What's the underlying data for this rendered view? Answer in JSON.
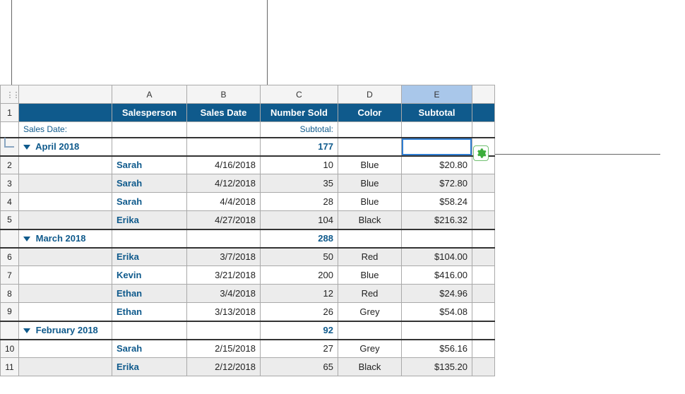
{
  "columns": {
    "A": "A",
    "B": "B",
    "C": "C",
    "D": "D",
    "E": "E"
  },
  "headers": {
    "salesperson": "Salesperson",
    "salesDate": "Sales Date",
    "numberSold": "Number Sold",
    "color": "Color",
    "subtotal": "Subtotal"
  },
  "labels": {
    "salesDate": "Sales Date:",
    "subtotal": "Subtotal:"
  },
  "rowNums": {
    "r1": "1",
    "r2": "2",
    "r3": "3",
    "r4": "4",
    "r5": "5",
    "r6": "6",
    "r7": "7",
    "r8": "8",
    "r9": "9",
    "r10": "10",
    "r11": "11"
  },
  "groups": [
    {
      "name": "April 2018",
      "numberSold": "177",
      "rows": [
        {
          "name": "Sarah",
          "date": "4/16/2018",
          "num": "10",
          "color": "Blue",
          "sub": "$20.80"
        },
        {
          "name": "Sarah",
          "date": "4/12/2018",
          "num": "35",
          "color": "Blue",
          "sub": "$72.80"
        },
        {
          "name": "Sarah",
          "date": "4/4/2018",
          "num": "28",
          "color": "Blue",
          "sub": "$58.24"
        },
        {
          "name": "Erika",
          "date": "4/27/2018",
          "num": "104",
          "color": "Black",
          "sub": "$216.32"
        }
      ]
    },
    {
      "name": "March 2018",
      "numberSold": "288",
      "rows": [
        {
          "name": "Erika",
          "date": "3/7/2018",
          "num": "50",
          "color": "Red",
          "sub": "$104.00"
        },
        {
          "name": "Kevin",
          "date": "3/21/2018",
          "num": "200",
          "color": "Blue",
          "sub": "$416.00"
        },
        {
          "name": "Ethan",
          "date": "3/4/2018",
          "num": "12",
          "color": "Red",
          "sub": "$24.96"
        },
        {
          "name": "Ethan",
          "date": "3/13/2018",
          "num": "26",
          "color": "Grey",
          "sub": "$54.08"
        }
      ]
    },
    {
      "name": "February 2018",
      "numberSold": "92",
      "rows": [
        {
          "name": "Sarah",
          "date": "2/15/2018",
          "num": "27",
          "color": "Grey",
          "sub": "$56.16"
        },
        {
          "name": "Erika",
          "date": "2/12/2018",
          "num": "65",
          "color": "Black",
          "sub": "$135.20"
        }
      ]
    }
  ]
}
